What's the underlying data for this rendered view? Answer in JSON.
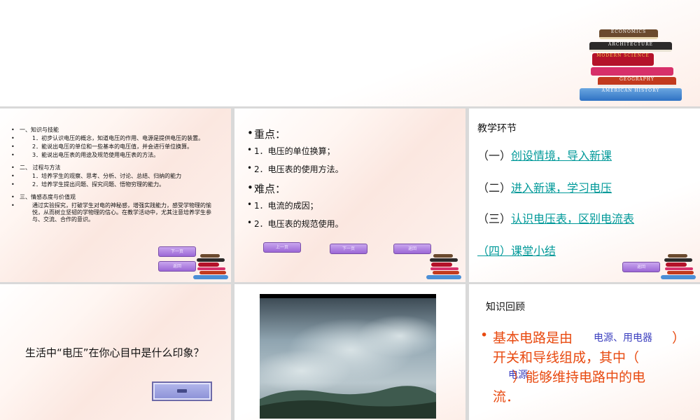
{
  "slide1": {
    "books": [
      "ECONOMICS",
      "ARCHITECTURE",
      "MODERN SCIENCE",
      "GEOGRAPHY",
      "AMERICAN HISTORY"
    ]
  },
  "slide2": {
    "objectives": [
      "一、知识与技能",
      "1．初步认识电压的概念，知道电压的作用、电源是提供电压的装置。",
      "2．能说出电压的单位和一些基本的电压值，并会进行单位换算。",
      "3．能说出电压表的用途及规范使用电压表的方法。",
      "二、 过程与方法",
      "1．培养学生的观察、思考、分析、讨论、总结、归纳的能力",
      "2．培养学生提出问题、探究问题、悟物穷理的能力。",
      "三、情感态度与价值观",
      "通过实验探究，打破学生对电的神秘感，增强实践能力，感受学物理的愉悦，从而树立坚韧的学物理的信心。在教学活动中，尤其注意培养学生参与、交流、合作的意识。"
    ],
    "btn_next": "下一页",
    "btn_back": "返回"
  },
  "slide3": {
    "key_title": "重点：",
    "key_items": [
      "1．电压的单位换算；",
      "2．电压表的使用方法。"
    ],
    "diff_title": "难点：",
    "diff_items": [
      "1．电流的成因；",
      "2．电压表的规范使用。"
    ],
    "btn_prev": "上一页",
    "btn_next": "下一页",
    "btn_back": "返回"
  },
  "slide4": {
    "title": "教学环节",
    "steps": [
      {
        "num": "（一）",
        "text": "创设情境，导入新课"
      },
      {
        "num": "（二）",
        "text": "进入新课，学习电压"
      },
      {
        "num": "（三）",
        "text": "认识电压表，区别电流表"
      },
      {
        "num": "（四）",
        "text": "课堂小结"
      }
    ],
    "btn_back": "返回"
  },
  "slide5": {
    "question": "生活中“电压”在你心目中是什么印象？"
  },
  "slide7": {
    "title": "知识回顾",
    "line1_a": "基本电路是由",
    "line1_b": "）",
    "line2": "开关和导线组成，其中（",
    "line3": "）能够维持电路中的电",
    "line4": "流．",
    "answer1": "电源、用电器",
    "answer2": "电源"
  },
  "colors": {
    "link": "#009999",
    "highlight_red": "#e8490f",
    "answer_blue": "#3b3fbf",
    "button_purple": "#9b67d6"
  }
}
